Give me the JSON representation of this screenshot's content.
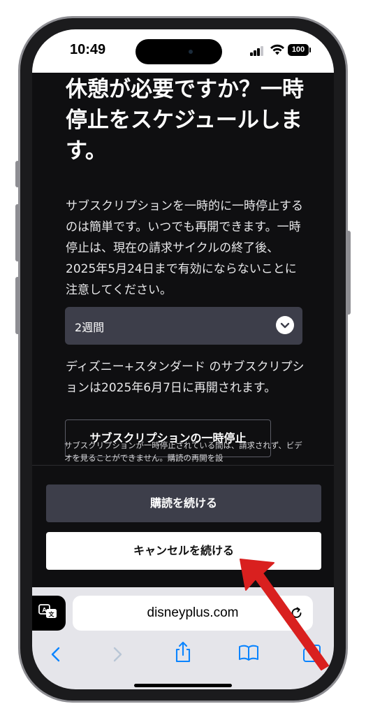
{
  "status_bar": {
    "time": "10:49",
    "battery": "100"
  },
  "page": {
    "heading": "休憩が必要ですか？一時停止をスケジュールします。",
    "description": "サブスクリプションを一時的に一時停止するのは簡単です。いつでも再開できます。一時停止は、現在の請求サイクルの終了後、2025年5月24日まで有効にならないことに注意してください。",
    "duration_dropdown": {
      "selected": "2週間"
    },
    "resume_info": "ディズニー+スタンダード のサブスクリプションは2025年6月7日に再開されます。",
    "pause_button": "サブスクリプションの一時停止",
    "notice": "サブスクリプションが一時停止されている間は、請求されず、ビデオを見ることができません。購読の再開を設"
  },
  "footer": {
    "continue_subscription": "購読を続ける",
    "continue_cancel": "キャンセルを続ける"
  },
  "browser": {
    "url": "disneyplus.com"
  },
  "colors": {
    "background": "#0f0f11",
    "secondary_button": "#3d3e4a",
    "primary_button": "#ffffff",
    "toolbar_icon": "#0a84ff",
    "annotation_arrow": "#d9201f"
  },
  "icons": [
    "signal-icon",
    "wifi-icon",
    "battery-icon",
    "chevron-down-icon",
    "translate-icon",
    "reload-icon",
    "back-icon",
    "forward-icon",
    "share-icon",
    "bookmarks-icon",
    "tabs-icon",
    "annotation-arrow-icon"
  ]
}
